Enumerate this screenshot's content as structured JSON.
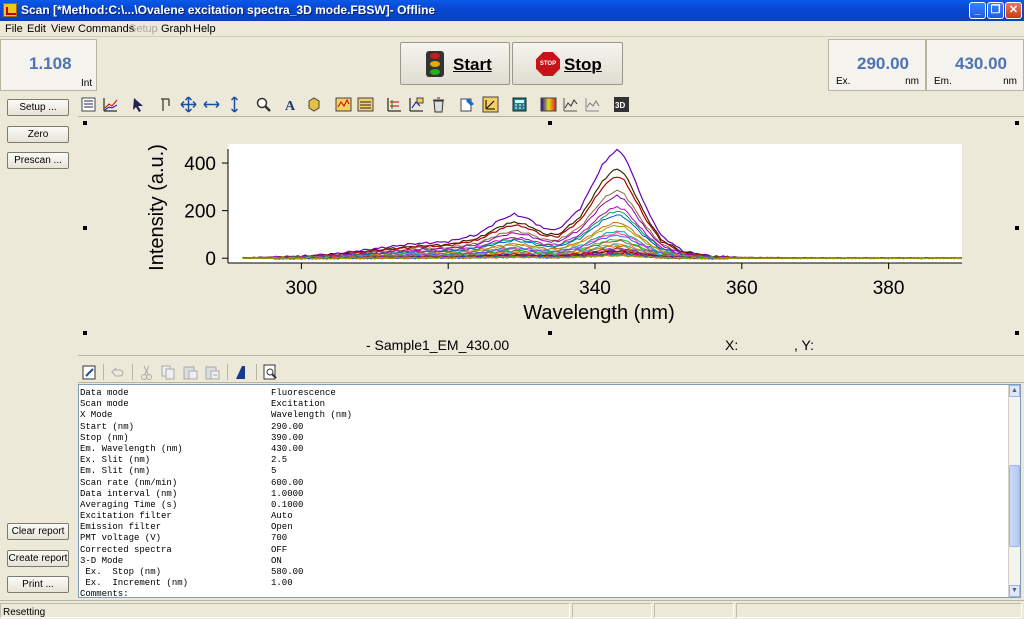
{
  "window": {
    "title": "Scan [*Method:C:\\...\\Ovalene excitation spectra_3D mode.FBSW]- Offline",
    "buttons": [
      "_",
      "❐",
      "✕"
    ]
  },
  "menu": [
    "File",
    "Edit",
    "View",
    "Commands",
    "Setup",
    "Graph",
    "Help"
  ],
  "top": {
    "intensity_value": "1.108",
    "intensity_unit": "Int",
    "start_label": "Start",
    "stop_label": "Stop",
    "stop_sign_text": "STOP",
    "ex_value": "290.00",
    "ex_tag": "Ex.",
    "ex_unit": "nm",
    "em_value": "430.00",
    "em_tag": "Em.",
    "em_unit": "nm"
  },
  "side": {
    "setup": "Setup ...",
    "zero": "Zero",
    "prescan": "Prescan ...",
    "clear_report": "Clear report",
    "create_report": "Create report",
    "print": "Print ..."
  },
  "toolbar_icons": [
    "list-icon",
    "chart-select-icon",
    "pointer-icon",
    "cursor-icon",
    "move-icon",
    "horizontal-scale-icon",
    "vertical-scale-icon",
    "zoom-icon",
    "text-annotation-icon",
    "shape-icon",
    "spectra-icon",
    "spectra-edit-icon",
    "overlay-icon",
    "baseline-icon",
    "delete-icon",
    "paint-icon",
    "axis-icon",
    "calculator-icon",
    "color-map-icon",
    "line-graph-icon",
    "line-graph-alt-icon",
    "3d-icon"
  ],
  "graph": {
    "legend": "- Sample1_EM_430.00",
    "x_label": "X:",
    "y_label": ", Y:"
  },
  "chart_data": {
    "type": "line",
    "title": "",
    "xlabel": "Wavelength (nm)",
    "ylabel": "Intensity (a.u.)",
    "xlim": [
      290,
      390
    ],
    "ylim": [
      -20,
      480
    ],
    "xticks": [
      300,
      320,
      340,
      360,
      380
    ],
    "yticks": [
      0,
      200,
      400
    ],
    "grid": false,
    "series_count": 30,
    "peak_profile": {
      "x": [
        290,
        300,
        305,
        310,
        315,
        320,
        324,
        327,
        329,
        331,
        333,
        335,
        338,
        340,
        341,
        342,
        343,
        344,
        345,
        347,
        349,
        352,
        356,
        360,
        370,
        380,
        390
      ],
      "y": [
        0,
        8,
        20,
        40,
        60,
        70,
        100,
        160,
        185,
        165,
        125,
        120,
        210,
        330,
        390,
        430,
        455,
        430,
        360,
        210,
        95,
        30,
        8,
        3,
        1,
        1,
        1
      ]
    },
    "colors": [
      "#6a00b8",
      "#3a2a00",
      "#b00000",
      "#8a6a3a",
      "#9000b0",
      "#c000c0",
      "#00a050",
      "#0060d0",
      "#d07000",
      "#a0a000",
      "#00a0a0",
      "#ff40a0",
      "#5050ff",
      "#20c020",
      "#806040",
      "#ff8000",
      "#00c0ff",
      "#c08000",
      "#4040a0",
      "#e02020"
    ]
  },
  "report": {
    "rows": [
      {
        "k": "Data mode",
        "v": "Fluorescence"
      },
      {
        "k": "Scan mode",
        "v": "Excitation"
      },
      {
        "k": "X Mode",
        "v": "Wavelength (nm)"
      },
      {
        "k": "Start (nm)",
        "v": "290.00"
      },
      {
        "k": "Stop (nm)",
        "v": "390.00"
      },
      {
        "k": "Em. Wavelength (nm)",
        "v": "430.00"
      },
      {
        "k": "Ex. Slit (nm)",
        "v": "2.5"
      },
      {
        "k": "Em. Slit (nm)",
        "v": "5"
      },
      {
        "k": "Scan rate (nm/min)",
        "v": "600.00"
      },
      {
        "k": "Data interval (nm)",
        "v": "1.0000"
      },
      {
        "k": "Averaging Time (s)",
        "v": "0.1000"
      },
      {
        "k": "Excitation filter",
        "v": "Auto"
      },
      {
        "k": "Emission filter",
        "v": "Open"
      },
      {
        "k": "PMT voltage (V)",
        "v": "700"
      },
      {
        "k": "Corrected spectra",
        "v": "OFF"
      },
      {
        "k": "3-D Mode",
        "v": "ON"
      },
      {
        "k": " Ex.  Stop (nm)",
        "v": "580.00"
      },
      {
        "k": " Ex.  Increment (nm)",
        "v": "1.00"
      },
      {
        "k": "Comments:",
        "v": ""
      }
    ]
  },
  "status": {
    "text": "Resetting"
  }
}
